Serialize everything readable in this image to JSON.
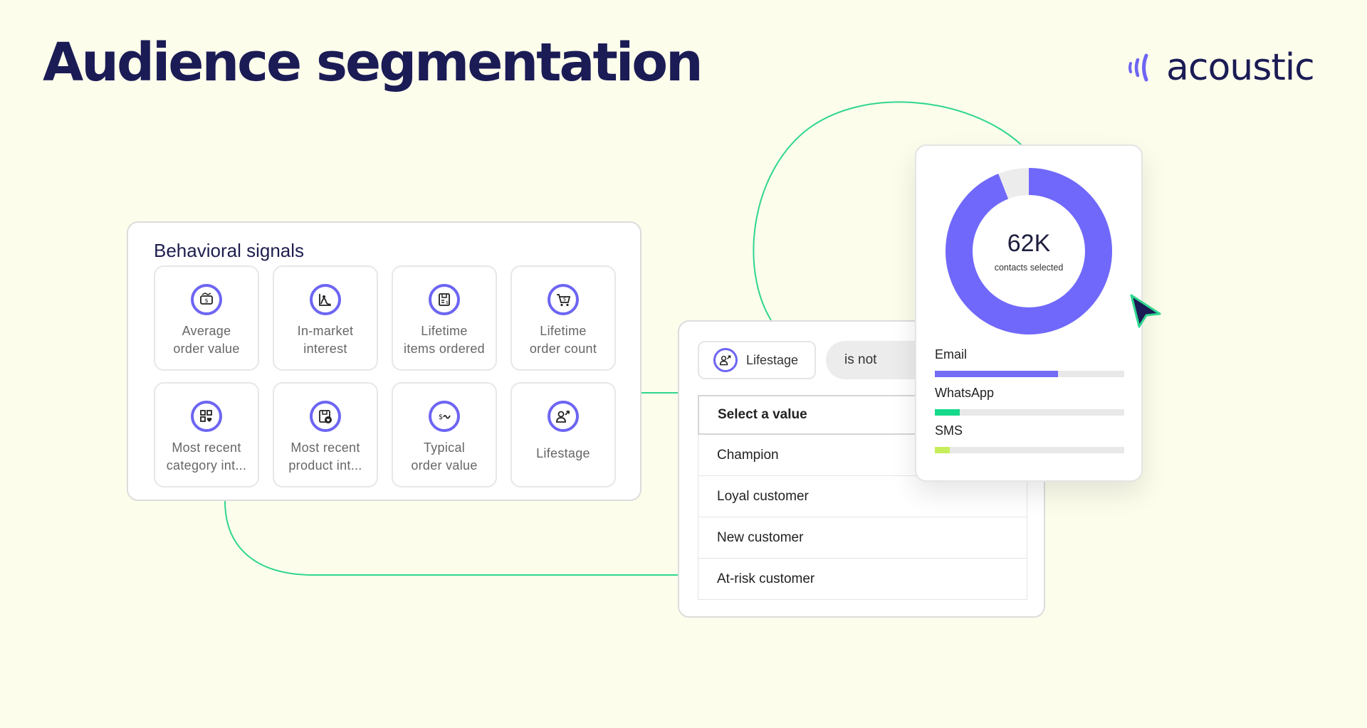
{
  "page": {
    "title": "Audience segmentation"
  },
  "brand": {
    "name": "acoustic",
    "color": "#6d65f2",
    "text_color": "#1b1b55"
  },
  "signals": {
    "title": "Behavioral signals",
    "tiles": [
      {
        "icon": "receipt-dollar-icon",
        "line1": "Average",
        "line2": "order value"
      },
      {
        "icon": "chart-peak-icon",
        "line1": "In-market",
        "line2": "interest"
      },
      {
        "icon": "box-list-icon",
        "line1": "Lifetime",
        "line2": "items ordered"
      },
      {
        "icon": "cart-dollar-icon",
        "line1": "Lifetime",
        "line2": "order count"
      },
      {
        "icon": "grid-heart-icon",
        "line1": "Most recent",
        "line2": "category int..."
      },
      {
        "icon": "box-heart-icon",
        "line1": "Most recent",
        "line2": "product int..."
      },
      {
        "icon": "dollar-wave-icon",
        "line1": "Typical",
        "line2": "order value"
      },
      {
        "icon": "user-growth-icon",
        "line1": "Lifestage",
        "line2": ""
      }
    ]
  },
  "filter": {
    "field_label": "Lifestage",
    "field_icon": "user-growth-icon",
    "operator": "is not",
    "placeholder": "Select a value",
    "options": [
      "Champion",
      "Loyal customer",
      "New customer",
      "At-risk customer"
    ]
  },
  "stats": {
    "count": "62K",
    "count_label": "contacts selected",
    "selected_fraction": 0.94,
    "donut_color": "#7068fb",
    "donut_rest_color": "#ececec",
    "channels": [
      {
        "name": "Email",
        "fraction": 0.65,
        "color": "#736cf5"
      },
      {
        "name": "WhatsApp",
        "fraction": 0.13,
        "color": "#17d98c"
      },
      {
        "name": "SMS",
        "fraction": 0.08,
        "color": "#c7ee5a"
      }
    ]
  },
  "connector_color": "#2fd68f"
}
